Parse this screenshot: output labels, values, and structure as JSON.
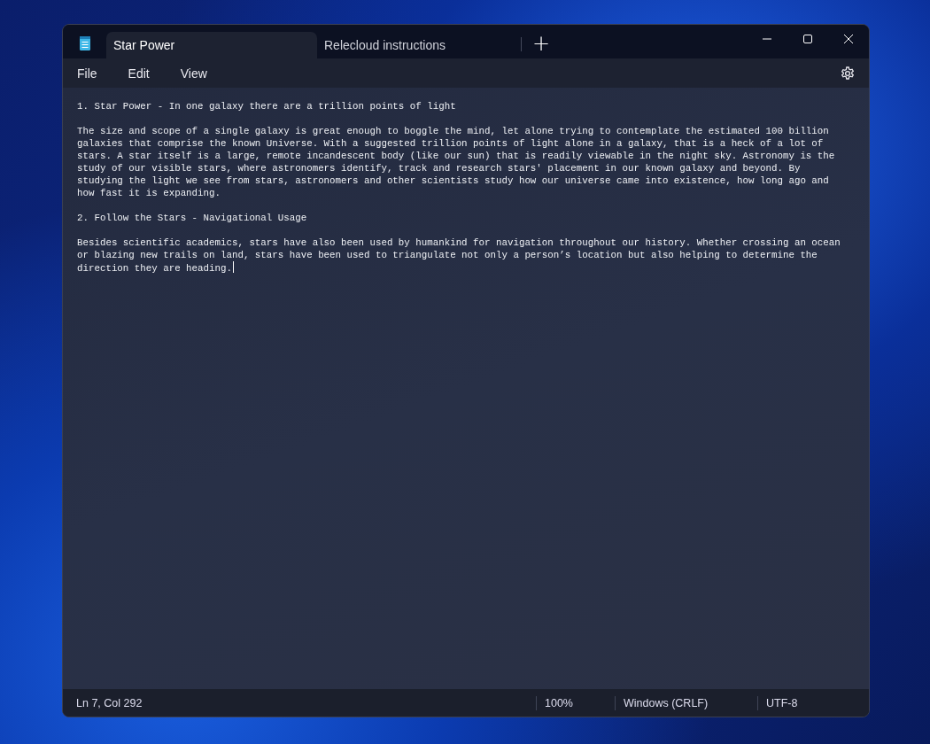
{
  "tabs": [
    {
      "label": "Star Power",
      "selected": true
    },
    {
      "label": "Relecloud instructions",
      "selected": false
    }
  ],
  "new_tab": "+",
  "menu": [
    "File",
    "Edit",
    "View"
  ],
  "document": {
    "paragraphs": [
      {
        "lines": [
          "1. Star Power - In one galaxy there are a trillion points of light"
        ]
      },
      {
        "lines": [
          "The size and scope of a single galaxy is great enough to boggle the mind, let alone trying to contemplate the estimated 100 billion",
          "galaxies that comprise the known Universe. With a suggested trillion points of light alone in a galaxy, that is a heck of a lot of",
          "stars. A star itself is a large, remote incandescent body (like our sun) that is readily viewable in the night sky. Astronomy is the",
          "study of our visible stars, where astronomers identify, track and research stars' placement in our known galaxy and beyond. By",
          "studying the light we see from stars, astronomers and other scientists study how our universe came into existence, how long ago and",
          "how fast it is expanding."
        ]
      },
      {
        "lines": [
          "2. Follow the Stars - Navigational Usage"
        ]
      },
      {
        "lines": [
          "Besides scientific academics, stars have also been used by humankind for navigation throughout our history. Whether crossing an ocean",
          "or blazing new trails on land, stars have been used to triangulate not only a person’s location but also helping to determine the",
          "direction they are heading."
        ]
      }
    ]
  },
  "status_bar": {
    "position": "Ln 7, Col 292",
    "zoom": "100%",
    "line_ending": "Windows (CRLF)",
    "encoding": "UTF-8"
  }
}
